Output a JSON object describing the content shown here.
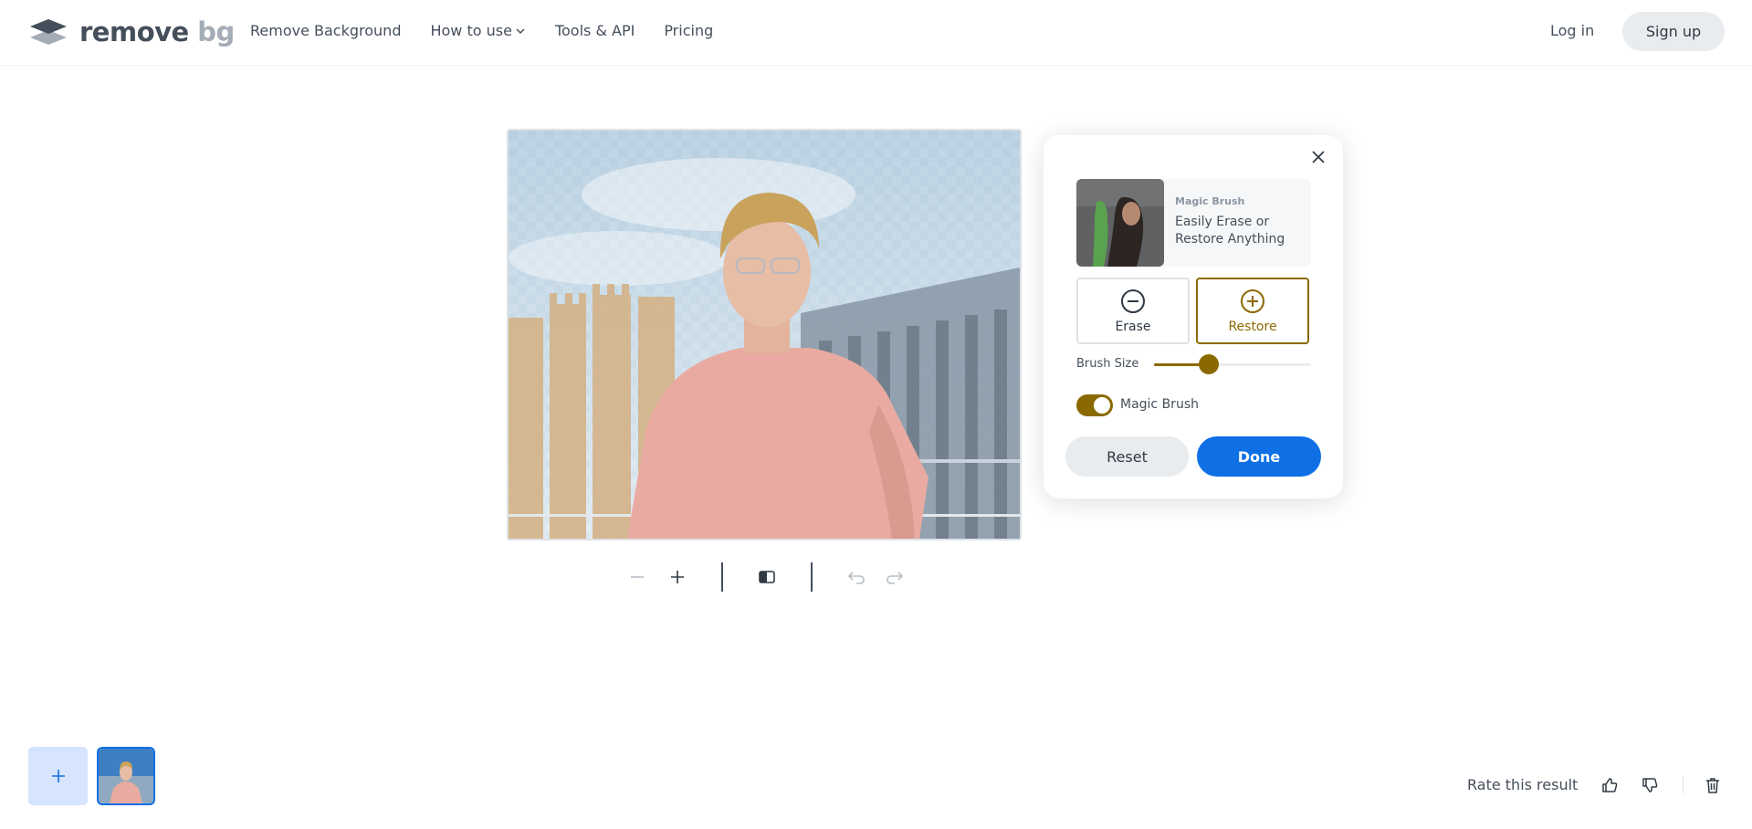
{
  "header": {
    "logo_text": "remove",
    "logo_suffix": "bg",
    "nav": [
      {
        "label": "Remove Background"
      },
      {
        "label": "How to use",
        "has_dropdown": true
      },
      {
        "label": "Tools & API"
      },
      {
        "label": "Pricing"
      }
    ],
    "login_label": "Log in",
    "signup_label": "Sign up"
  },
  "toolbar": {
    "icons": [
      "minus-icon",
      "plus-icon",
      "compare-icon",
      "undo-icon",
      "redo-icon"
    ]
  },
  "editor": {
    "promo_tag": "Magic Brush",
    "promo_text": "Easily Erase or Restore Anything",
    "erase_label": "Erase",
    "restore_label": "Restore",
    "active_mode": "Restore",
    "brush_size_label": "Brush Size",
    "brush_size_fraction": 0.35,
    "magic_brush_label": "Magic Brush",
    "magic_brush_on": true,
    "reset_label": "Reset",
    "done_label": "Done"
  },
  "footer": {
    "rate_label": "Rate this result"
  },
  "colors": {
    "accent": "#8a6a00",
    "primary": "#0f70e6",
    "text": "#454f5b"
  }
}
